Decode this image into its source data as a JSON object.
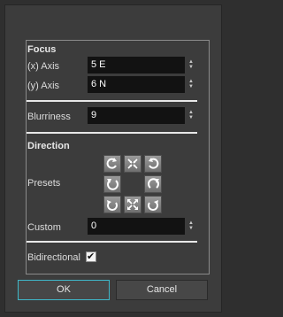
{
  "focus": {
    "header": "Focus",
    "x_label": "(x) Axis",
    "x_value": "5 E",
    "y_label": "(y) Axis",
    "y_value": "6 N"
  },
  "blurriness": {
    "label": "Blurriness",
    "value": "9"
  },
  "direction": {
    "header": "Direction",
    "presets_label": "Presets",
    "custom_label": "Custom",
    "custom_value": "0",
    "preset_icons": [
      "rotate-cw-small-icon",
      "center-inward-icon",
      "rotate-ccw-small-icon",
      "rotate-ccw-icon",
      "rotate-cw-icon",
      "rotate-cw-arc-icon",
      "center-outward-icon",
      "rotate-ccw-arc-icon"
    ]
  },
  "bidirectional": {
    "label": "Bidirectional",
    "checked": true,
    "check_glyph": "✔"
  },
  "buttons": {
    "ok": "OK",
    "cancel": "Cancel"
  },
  "colors": {
    "background": "#3c3c3c",
    "field": "#121212",
    "accent": "#3fb8c9"
  }
}
